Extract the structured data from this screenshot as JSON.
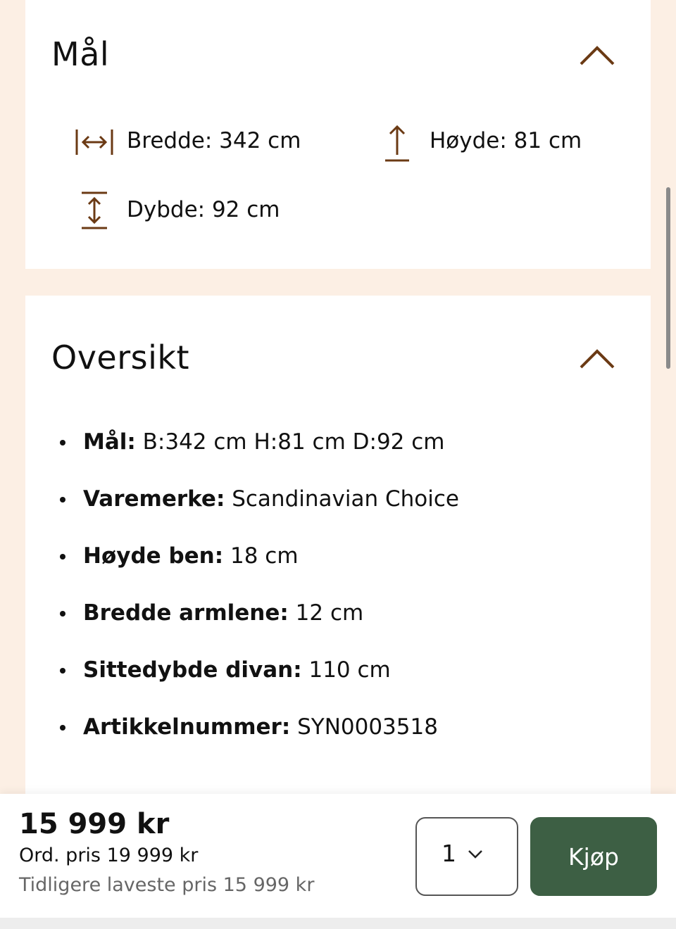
{
  "dimensions_section": {
    "title": "Mål",
    "width_label": "Bredde: 342 cm",
    "height_label": "Høyde: 81 cm",
    "depth_label": "Dybde: 92 cm"
  },
  "overview_section": {
    "title": "Oversikt",
    "items": [
      {
        "key": "Mål:",
        "value": " B:342 cm H:81 cm D:92 cm"
      },
      {
        "key": "Varemerke:",
        "value": " Scandinavian Choice"
      },
      {
        "key": "Høyde ben:",
        "value": " 18 cm"
      },
      {
        "key": "Bredde armlene:",
        "value": " 12 cm"
      },
      {
        "key": "Sittedybde divan:",
        "value": " 110 cm"
      },
      {
        "key": "Artikkelnummer:",
        "value": " SYN0003518"
      }
    ]
  },
  "purchase_bar": {
    "price": "15 999 kr",
    "ordinary_price": "Ord. pris 19 999 kr",
    "lowest_price": "Tidligere laveste pris 15 999 kr",
    "quantity": "1",
    "buy_label": "Kjøp"
  },
  "colors": {
    "page_bg": "#fcefe4",
    "accent_brown": "#6b3a14",
    "buy_button": "#3d5f44"
  },
  "icons": [
    "chevron-up-icon",
    "width-arrows-icon",
    "height-arrow-icon",
    "depth-arrows-icon",
    "chevron-down-icon"
  ]
}
